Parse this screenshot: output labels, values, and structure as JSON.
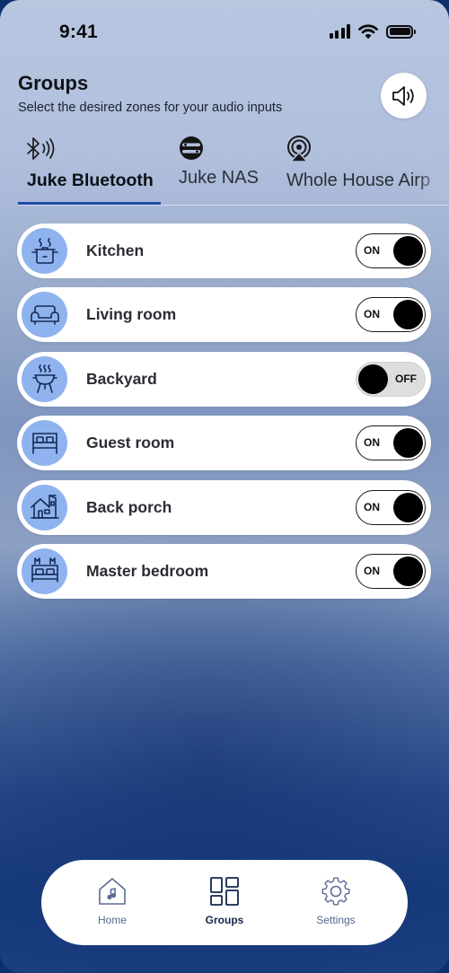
{
  "status_bar": {
    "time": "9:41"
  },
  "header": {
    "title": "Groups",
    "subtitle": "Select the desired zones for your audio inputs",
    "volume_icon": "speaker-volume-icon"
  },
  "tabs": [
    {
      "label": "Juke Bluetooth",
      "icon": "bluetooth-audio-icon",
      "active": true
    },
    {
      "label": "Juke NAS",
      "icon": "nas-stack-icon",
      "active": false
    },
    {
      "label": "Whole House Airp",
      "icon": "airplay-audio-icon",
      "active": false
    }
  ],
  "rooms": [
    {
      "name": "Kitchen",
      "icon": "cooking-pot-icon",
      "state": "ON"
    },
    {
      "name": "Living room",
      "icon": "sofa-icon",
      "state": "ON"
    },
    {
      "name": "Backyard",
      "icon": "grill-icon",
      "state": "OFF"
    },
    {
      "name": "Guest room",
      "icon": "bed-icon",
      "state": "ON"
    },
    {
      "name": "Back porch",
      "icon": "house-porch-icon",
      "state": "ON"
    },
    {
      "name": "Master bedroom",
      "icon": "master-bed-icon",
      "state": "ON"
    }
  ],
  "nav": [
    {
      "label": "Home",
      "icon": "home-music-icon",
      "active": false
    },
    {
      "label": "Groups",
      "icon": "grid-groups-icon",
      "active": true
    },
    {
      "label": "Settings",
      "icon": "gear-icon",
      "active": false
    }
  ],
  "colors": {
    "accent": "#1f4aa8",
    "room_icon_bg": "#8fb3ee",
    "toggle_knob": "#000000",
    "toggle_off_bg": "#dedede"
  }
}
